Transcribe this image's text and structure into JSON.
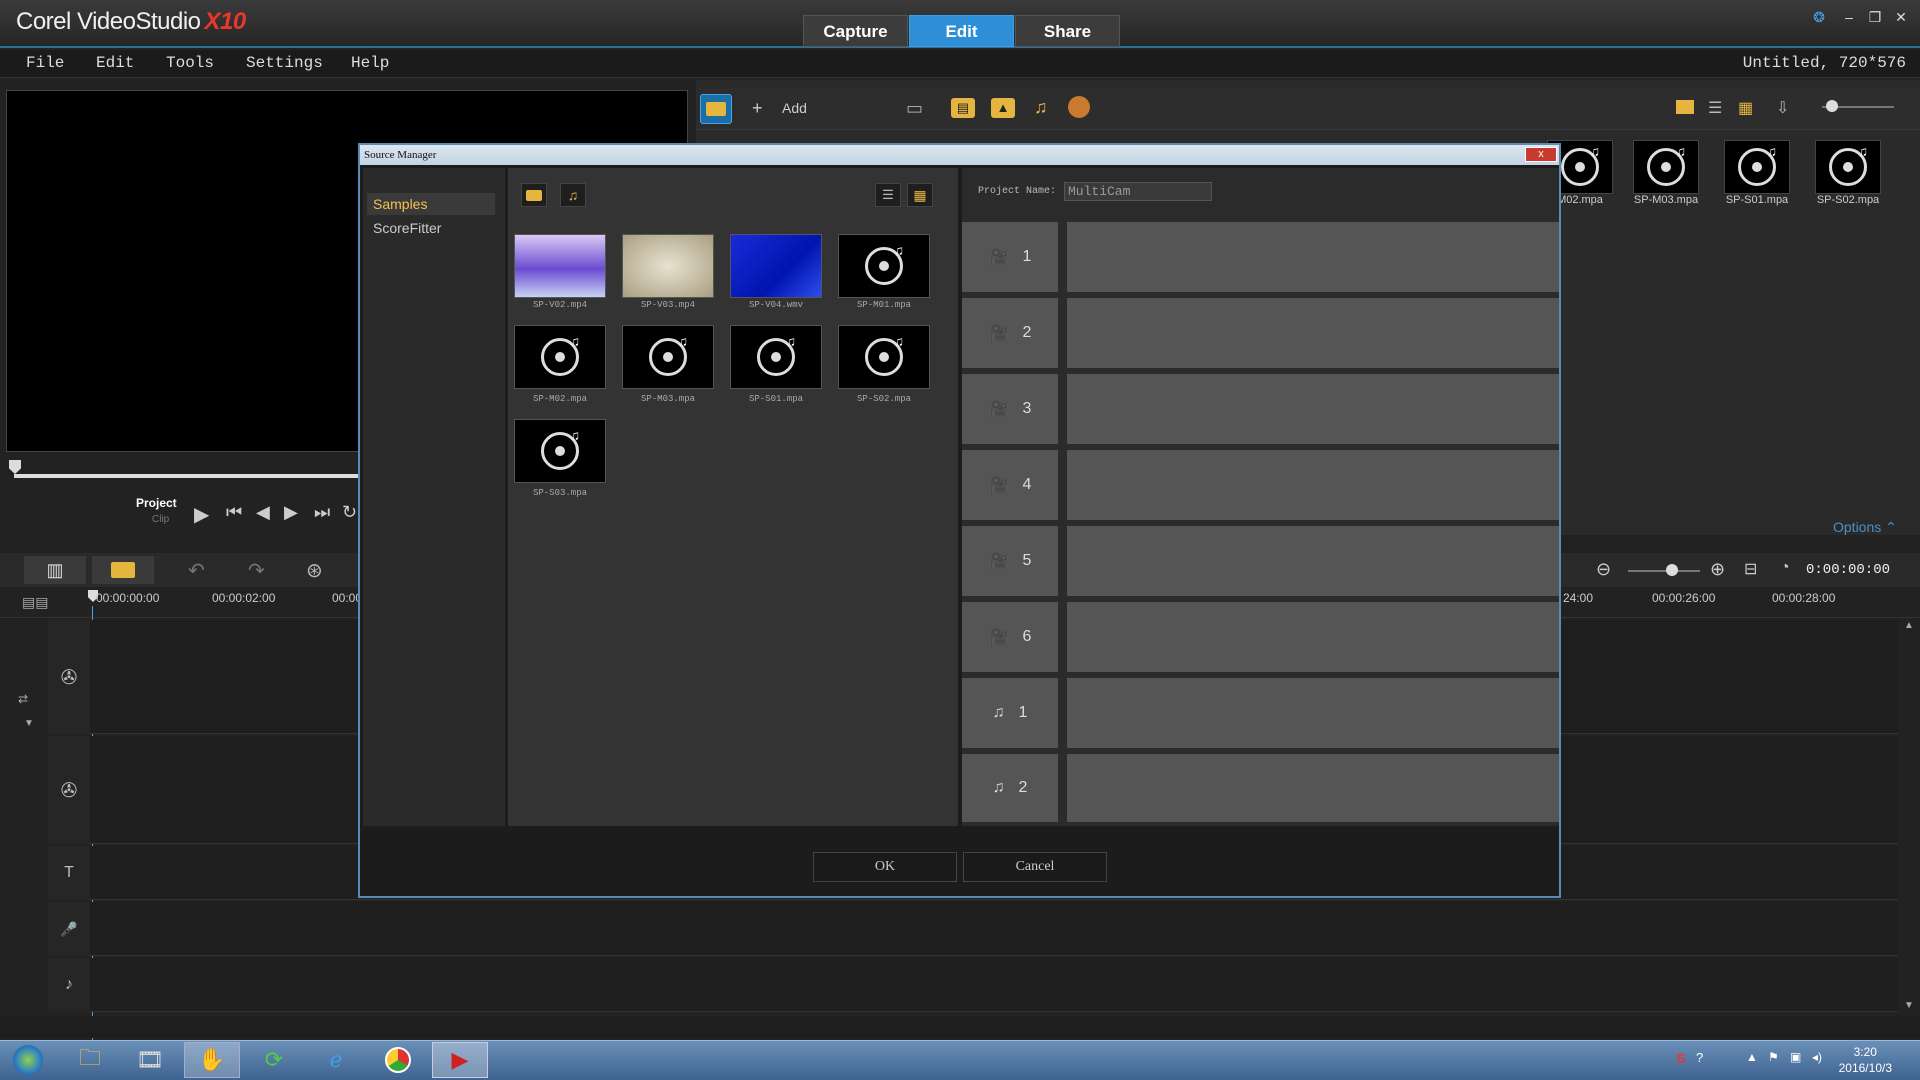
{
  "app": {
    "title": "Corel VideoStudio",
    "title_badge": "X10"
  },
  "mode_tabs": [
    {
      "label": "Capture"
    },
    {
      "label": "Edit"
    },
    {
      "label": "Share"
    }
  ],
  "menubar": {
    "items": [
      {
        "label": "File"
      },
      {
        "label": "Edit"
      },
      {
        "label": "Tools"
      },
      {
        "label": "Settings"
      },
      {
        "label": "Help"
      }
    ],
    "project_info": "Untitled, 720*576"
  },
  "player": {
    "project_label": "Project",
    "clip_label": "Clip"
  },
  "library": {
    "add_label": "Add",
    "options_label": "Options",
    "thumbs": [
      {
        "label": "M02.mpa"
      },
      {
        "label": "SP-M03.mpa"
      },
      {
        "label": "SP-S01.mpa"
      },
      {
        "label": "SP-S02.mpa"
      }
    ]
  },
  "timeline": {
    "timecode": "0:00:00:00",
    "ticks": [
      "00:00:00:00",
      "00:00:02:00",
      "00:00",
      "24:00",
      "00:00:26:00",
      "00:00:28:00"
    ]
  },
  "dialog": {
    "title": "Source Manager",
    "close_label": "x",
    "left_items": [
      {
        "label": "Samples"
      },
      {
        "label": "ScoreFitter"
      }
    ],
    "project_name_label": "Project Name:",
    "project_name_value": "MultiCam",
    "sources": [
      {
        "label": "SP-V02.mp4",
        "kind": "video-lavender"
      },
      {
        "label": "SP-V03.mp4",
        "kind": "video-beige"
      },
      {
        "label": "SP-V04.wmv",
        "kind": "video-blue"
      },
      {
        "label": "SP-M01.mpa",
        "kind": "audio"
      },
      {
        "label": "SP-M02.mpa",
        "kind": "audio"
      },
      {
        "label": "SP-M03.mpa",
        "kind": "audio"
      },
      {
        "label": "SP-S01.mpa",
        "kind": "audio"
      },
      {
        "label": "SP-S02.mpa",
        "kind": "audio"
      },
      {
        "label": "SP-S03.mpa",
        "kind": "audio"
      }
    ],
    "camera_rows": [
      {
        "num": "1"
      },
      {
        "num": "2"
      },
      {
        "num": "3"
      },
      {
        "num": "4"
      },
      {
        "num": "5"
      },
      {
        "num": "6"
      }
    ],
    "audio_rows": [
      {
        "num": "1"
      },
      {
        "num": "2"
      }
    ],
    "ok_label": "OK",
    "cancel_label": "Cancel"
  },
  "taskbar": {
    "time": "3:20",
    "date": "2016/10/3"
  },
  "colors": {
    "accent": "#2e8fd6",
    "highlight": "#f4c24a",
    "brand_red": "#e8382c",
    "dialog_border": "#5b8bb5"
  }
}
